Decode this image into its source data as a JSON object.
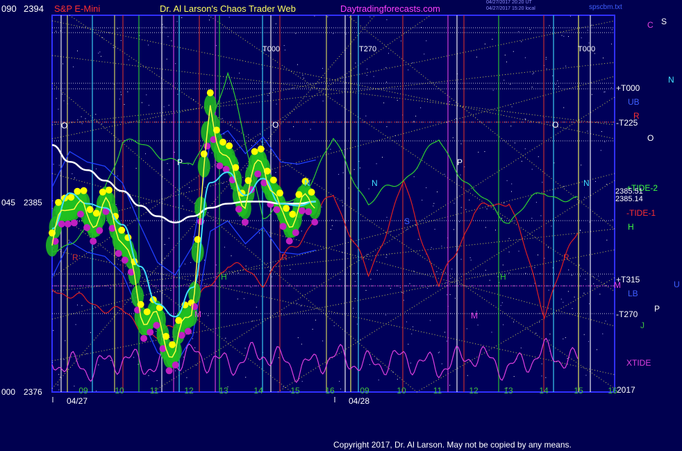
{
  "header": {
    "left_code": "090",
    "symbol": "S&P E-Mini",
    "title": "Dr. Al Larson's Chaos Trader Web",
    "site": "Daytradingforecasts.com",
    "stamp1": "04/27/2017 20:20 UT",
    "stamp2": "04/27/2017 15:20 local",
    "file": "spscbm.txt",
    "top_price": "2394"
  },
  "copyright": "Copyright 2017, Dr. Al Larson. May not be copied by any means.",
  "colors": {
    "background": "#000050",
    "plot_border": "#3030ff",
    "grid_yellow": "#ffff50",
    "tide_red": "#e02020",
    "tide_green": "#30d030",
    "xtide_magenta": "#e040e0",
    "price_yellow": "#ffff00",
    "price_bar_green": "#20c020",
    "ma_white": "#ffffff",
    "ma_cyan": "#40e0ff"
  },
  "chart_data": {
    "type": "line",
    "title": "S&P E-Mini",
    "xlabel": "",
    "ylabel": "",
    "ylim": [
      2376,
      2394
    ],
    "y_ticks": [
      {
        "code": "000",
        "price": "2376"
      },
      {
        "code": "045",
        "price": "2385"
      },
      {
        "code": "090",
        "price": "2394"
      }
    ],
    "x_hour_labels": [
      "09",
      "10",
      "11",
      "12",
      "13",
      "14",
      "15",
      "16",
      "09",
      "10",
      "11",
      "12",
      "13",
      "14",
      "15",
      "16"
    ],
    "x_date_labels": [
      "04/27",
      "04/28"
    ],
    "year_label": "2017",
    "right_labels": [
      "+T000",
      "UB",
      "R",
      "-T225",
      "O",
      "+TIDE-2",
      "2385.51",
      "2385.14",
      "-TIDE-1",
      "H",
      "+T315",
      "M",
      "LB",
      "-T270",
      "P",
      "J",
      "XTIDE",
      "C",
      "S",
      "N",
      "U"
    ],
    "top_labels": [
      "T000",
      "T270",
      "T000"
    ],
    "planet_markers": [
      "O",
      "P",
      "O",
      "N",
      "N",
      "P",
      "O",
      "N",
      "R",
      "R",
      "R",
      "S",
      "H",
      "H",
      "M",
      "M"
    ],
    "series": [
      {
        "name": "Price",
        "x": [
          0,
          0.5,
          1,
          1.5,
          2,
          2.5,
          3,
          3.5,
          4,
          4.5,
          5,
          5.5,
          6,
          6.5,
          7,
          7.5
        ],
        "values": [
          2383.0,
          2385.4,
          2384.2,
          2384.8,
          2383.6,
          2380.0,
          2379.2,
          2377.8,
          2380.4,
          2389.5,
          2386.7,
          2385.2,
          2387.3,
          2384.2,
          2384.6,
          2385.4
        ]
      },
      {
        "name": "Moving average",
        "x": [
          0,
          0.5,
          1,
          1.5,
          2,
          2.5,
          3,
          3.5,
          4,
          4.5,
          5,
          5.5,
          6,
          6.5,
          7,
          7.5
        ],
        "values": [
          2383.8,
          2385.5,
          2385.0,
          2384.8,
          2384.0,
          2382.0,
          2380.2,
          2379.6,
          2381.0,
          2386.0,
          2386.5,
          2385.4,
          2386.2,
          2385.0,
          2384.9,
          2385.1
        ]
      },
      {
        "name": "Slow average",
        "x": [
          0,
          0.5,
          1,
          1.5,
          2,
          2.5,
          3,
          3.5,
          4,
          4.5,
          5,
          5.5,
          6,
          6.5,
          7,
          7.5
        ],
        "values": [
          2387.8,
          2387.0,
          2386.6,
          2386.1,
          2385.6,
          2384.9,
          2384.4,
          2384.1,
          2384.4,
          2384.8,
          2385.0,
          2385.1,
          2385.1,
          2385.0,
          2385.0,
          2385.1
        ]
      },
      {
        "name": "TIDE-1",
        "x": [
          0,
          1,
          2,
          3,
          4,
          5,
          6,
          7,
          8,
          9,
          10,
          11,
          12,
          13,
          14,
          15
        ],
        "values": [
          2381.0,
          2380.3,
          2379.8,
          2378.5,
          2380.0,
          2382.2,
          2381.3,
          2383.2,
          2385.5,
          2381.5,
          2386.0,
          2381.0,
          2384.6,
          2385.2,
          2379.8,
          2384.0
        ]
      },
      {
        "name": "TIDE-2",
        "x": [
          0,
          1,
          2,
          3,
          4,
          5,
          6,
          7,
          8,
          9,
          10,
          11,
          12,
          13,
          14,
          15
        ],
        "values": [
          2382.8,
          2383.6,
          2388.0,
          2387.5,
          2386.6,
          2391.2,
          2384.5,
          2385.2,
          2388.0,
          2385.0,
          2386.2,
          2388.0,
          2385.5,
          2384.2,
          2385.6,
          2385.0
        ]
      },
      {
        "name": "XTIDE",
        "x": [
          0,
          1,
          2,
          3,
          4,
          5,
          6,
          7,
          8,
          9,
          10,
          11,
          12,
          13,
          14,
          15
        ],
        "values": [
          2377.5,
          2377.1,
          2377.6,
          2377.2,
          2377.8,
          2377.3,
          2377.9,
          2377.1,
          2377.7,
          2377.3,
          2377.6,
          2377.2,
          2377.8,
          2377.1,
          2377.9,
          2377.4
        ]
      }
    ]
  }
}
